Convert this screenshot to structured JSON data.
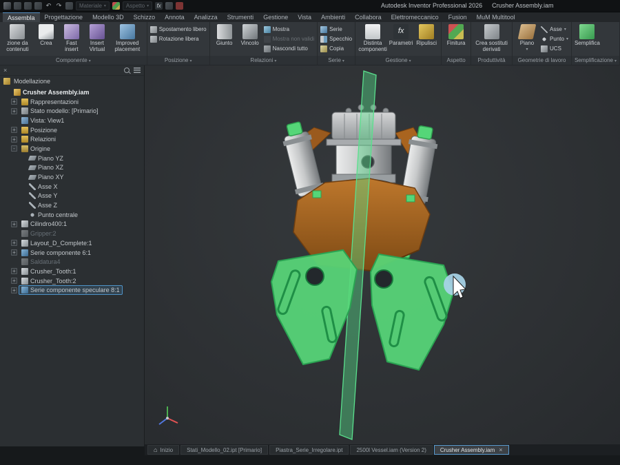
{
  "colors": {
    "highlight_green": "#55d678",
    "body_orange": "#a9641f",
    "selection_blue": "#4f94c9",
    "cursor_halo_blue": "#a8d4e8",
    "ribbon_bg": "#33373b"
  },
  "titlebar": {
    "app_title": "Autodesk Inventor Professional 2026",
    "doc_title": "Crusher Assembly.iam",
    "material_label": "Materiale",
    "appearance_label": "Aspetto"
  },
  "ribbon": {
    "tabs": [
      {
        "label": "Assembla",
        "active": true
      },
      {
        "label": "Progettazione"
      },
      {
        "label": "Modello 3D"
      },
      {
        "label": "Schizzo"
      },
      {
        "label": "Annota"
      },
      {
        "label": "Analizza"
      },
      {
        "label": "Strumenti"
      },
      {
        "label": "Gestione"
      },
      {
        "label": "Vista"
      },
      {
        "label": "Ambienti"
      },
      {
        "label": "Collabora"
      },
      {
        "label": "Elettromeccanico"
      },
      {
        "label": "Fusion"
      },
      {
        "label": "MuM Multitool"
      }
    ],
    "groups": [
      {
        "id": "componente",
        "label": "Componente",
        "caret": true,
        "buttons": [
          {
            "label": "zione da contenuti",
            "icon": "content",
            "size": "lg"
          },
          {
            "label": "Crea",
            "icon": "create",
            "size": "lg"
          },
          {
            "label": "Fast insert",
            "icon": "fast-insert",
            "size": "lg"
          },
          {
            "label": "Insert Virtual",
            "icon": "insert-virtual",
            "size": "lg"
          },
          {
            "label": "Improved placement",
            "icon": "improved-placement",
            "size": "lg"
          }
        ]
      },
      {
        "id": "posizione",
        "label": "Posizione",
        "caret": true,
        "buttons": [
          {
            "label": "Spostamento libero",
            "icon": "free-move",
            "size": "sm"
          },
          {
            "label": "Rotazione libera",
            "icon": "free-rotate",
            "size": "sm"
          }
        ]
      },
      {
        "id": "relazioni",
        "label": "Relazioni",
        "caret": true,
        "buttons": [
          {
            "label": "Giunto",
            "icon": "joint",
            "size": "lg"
          },
          {
            "label": "Vincolo",
            "icon": "constrain",
            "size": "lg"
          },
          {
            "label": "Mostra",
            "icon": "show",
            "size": "sm"
          },
          {
            "label": "Mostra non validi",
            "icon": "show-sick",
            "size": "sm",
            "dim": true
          },
          {
            "label": "Nascondi tutto",
            "icon": "hide-all",
            "size": "sm"
          }
        ]
      },
      {
        "id": "serie",
        "label": "Serie",
        "caret": true,
        "buttons": [
          {
            "label": "Serie",
            "icon": "pattern",
            "size": "sm"
          },
          {
            "label": "Specchio",
            "icon": "mirror",
            "size": "sm"
          },
          {
            "label": "Copia",
            "icon": "copy",
            "size": "sm"
          }
        ]
      },
      {
        "id": "gestione",
        "label": "Gestione",
        "caret": true,
        "buttons": [
          {
            "label": "Distinta componenti",
            "icon": "bom",
            "size": "lg"
          },
          {
            "label": "Parametri",
            "icon": "fx",
            "size": "lg"
          },
          {
            "label": "Ripulisci",
            "icon": "purge",
            "size": "lg"
          }
        ]
      },
      {
        "id": "aspetto",
        "label": "Aspetto",
        "buttons": [
          {
            "label": "Finitura",
            "icon": "finish",
            "size": "lg"
          }
        ]
      },
      {
        "id": "produttivita",
        "label": "Produttività",
        "buttons": [
          {
            "label": "Crea sostituti derivati",
            "icon": "derive",
            "size": "lg"
          }
        ]
      },
      {
        "id": "geometrie",
        "label": "Geometrie di lavoro",
        "buttons": [
          {
            "label": "Piano",
            "icon": "work-plane",
            "size": "lg",
            "caret": true
          },
          {
            "label": "Asse",
            "icon": "work-axis",
            "size": "sm",
            "caret": true
          },
          {
            "label": "Punto",
            "icon": "work-point",
            "size": "sm",
            "caret": true
          },
          {
            "label": "UCS",
            "icon": "ucs",
            "size": "sm"
          }
        ]
      },
      {
        "id": "semplificazione",
        "label": "Semplificazione",
        "caret": true,
        "buttons": [
          {
            "label": "Semplifica",
            "icon": "simplify",
            "size": "lg"
          }
        ]
      }
    ]
  },
  "browser": {
    "mode_label": "Modellazione",
    "items": [
      {
        "label": "Crusher Assembly.iam",
        "indent": 0,
        "icon": "assembly",
        "bold": true
      },
      {
        "label": "Rappresentazioni",
        "indent": 1,
        "expand": "+",
        "icon": "folder"
      },
      {
        "label": "Stato modello: [Primario]",
        "indent": 1,
        "expand": "+",
        "icon": "state"
      },
      {
        "label": "Vista: View1",
        "indent": 1,
        "icon": "view"
      },
      {
        "label": "Posizione",
        "indent": 1,
        "expand": "+",
        "icon": "folder"
      },
      {
        "label": "Relazioni",
        "indent": 1,
        "expand": "+",
        "icon": "folder"
      },
      {
        "label": "Origine",
        "indent": 1,
        "expand": "-",
        "icon": "origin"
      },
      {
        "label": "Piano YZ",
        "indent": 2,
        "icon": "plane"
      },
      {
        "label": "Piano XZ",
        "indent": 2,
        "icon": "plane"
      },
      {
        "label": "Piano XY",
        "indent": 2,
        "icon": "plane"
      },
      {
        "label": "Asse X",
        "indent": 2,
        "icon": "axis"
      },
      {
        "label": "Asse Y",
        "indent": 2,
        "icon": "axis"
      },
      {
        "label": "Asse Z",
        "indent": 2,
        "icon": "axis"
      },
      {
        "label": "Punto centrale",
        "indent": 2,
        "icon": "point"
      },
      {
        "label": "Cilindro400:1",
        "indent": 1,
        "expand": "+",
        "icon": "part"
      },
      {
        "label": "Gripper:2",
        "indent": 1,
        "icon": "part",
        "dim": true
      },
      {
        "label": "Layout_D_Complete:1",
        "indent": 1,
        "expand": "+",
        "icon": "part"
      },
      {
        "label": "Serie componente 6:1",
        "indent": 1,
        "expand": "+",
        "icon": "pattern"
      },
      {
        "label": "Saldatura4",
        "indent": 1,
        "icon": "part",
        "dim": true
      },
      {
        "label": "Crusher_Tooth:1",
        "indent": 1,
        "expand": "+",
        "icon": "part"
      },
      {
        "label": "Crusher_Tooth:2",
        "indent": 1,
        "expand": "+",
        "icon": "part"
      },
      {
        "label": "Serie componente speculare 8:1",
        "indent": 1,
        "expand": "+",
        "icon": "pattern",
        "selected": true
      }
    ]
  },
  "doc_tabs": [
    {
      "label": "Inizio",
      "home": true
    },
    {
      "label": "Stati_Modello_02.ipt [Primario]"
    },
    {
      "label": "Piastra_Serie_Irregolare.ipt"
    },
    {
      "label": "2500l Vessel.iam (Version 2)"
    },
    {
      "label": "Crusher Assembly.iam",
      "active": true,
      "close": true
    }
  ]
}
